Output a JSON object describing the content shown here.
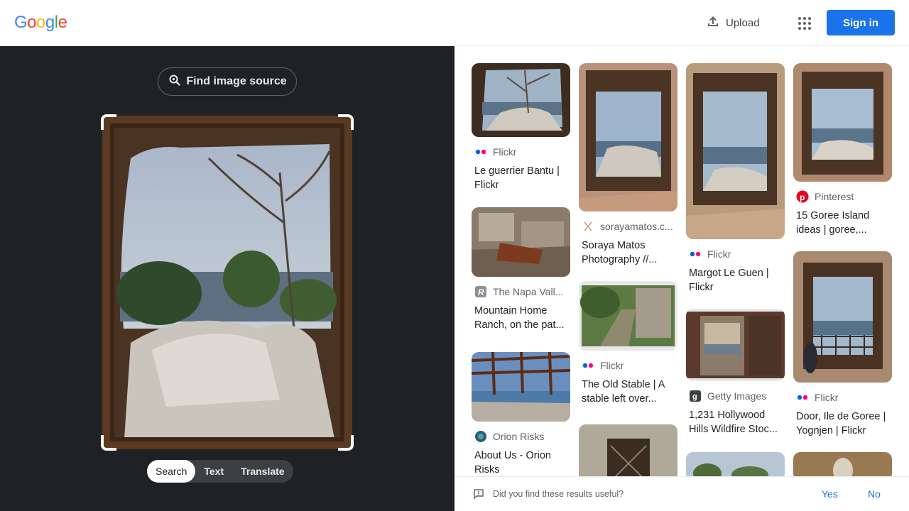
{
  "header": {
    "logo": [
      "G",
      "o",
      "o",
      "g",
      "l",
      "e"
    ],
    "logo_colors": [
      "#4285f4",
      "#ea4335",
      "#fbbc05",
      "#4285f4",
      "#34a853",
      "#ea4335"
    ],
    "upload_label": "Upload",
    "signin_label": "Sign in"
  },
  "left": {
    "find_source_label": "Find image source",
    "tabs": [
      "Search",
      "Text",
      "Translate"
    ],
    "active_tab": "Search"
  },
  "results": [
    {
      "source": "Flickr",
      "title": "Le guerrier Bantu | Flickr",
      "favicon": "flickr-icon"
    },
    {
      "source": "sorayamatos.c...",
      "title": "Soraya Matos Photography //...",
      "favicon": "sorayamatos-icon"
    },
    {
      "source": "Flickr",
      "title": "Margot Le Guen | Flickr",
      "favicon": "flickr-icon"
    },
    {
      "source": "Pinterest",
      "title": "15 Goree Island ideas | goree,...",
      "favicon": "pinterest-icon"
    },
    {
      "source": "The Napa Vall...",
      "title": "Mountain Home Ranch, on the pat...",
      "favicon": "napa-valley-icon"
    },
    {
      "source": "Flickr",
      "title": "The Old Stable | A stable left over...",
      "favicon": "flickr-icon"
    },
    {
      "source": "Getty Images",
      "title": "1,231 Hollywood Hills Wildfire Stoc...",
      "favicon": "getty-images-icon"
    },
    {
      "source": "Flickr",
      "title": "Door, Ile de Goree | Yognjen | Flickr",
      "favicon": "flickr-icon"
    },
    {
      "source": "Orion Risks",
      "title": "About Us - Orion Risks",
      "favicon": "orion-risks-icon"
    }
  ],
  "feedback": {
    "question": "Did you find these results useful?",
    "yes": "Yes",
    "no": "No"
  },
  "colors": {
    "accent": "#1a73e8",
    "dark_pane": "#202124",
    "flickr_blue": "#0063dc",
    "flickr_pink": "#ff0084",
    "pinterest_red": "#e60023"
  }
}
